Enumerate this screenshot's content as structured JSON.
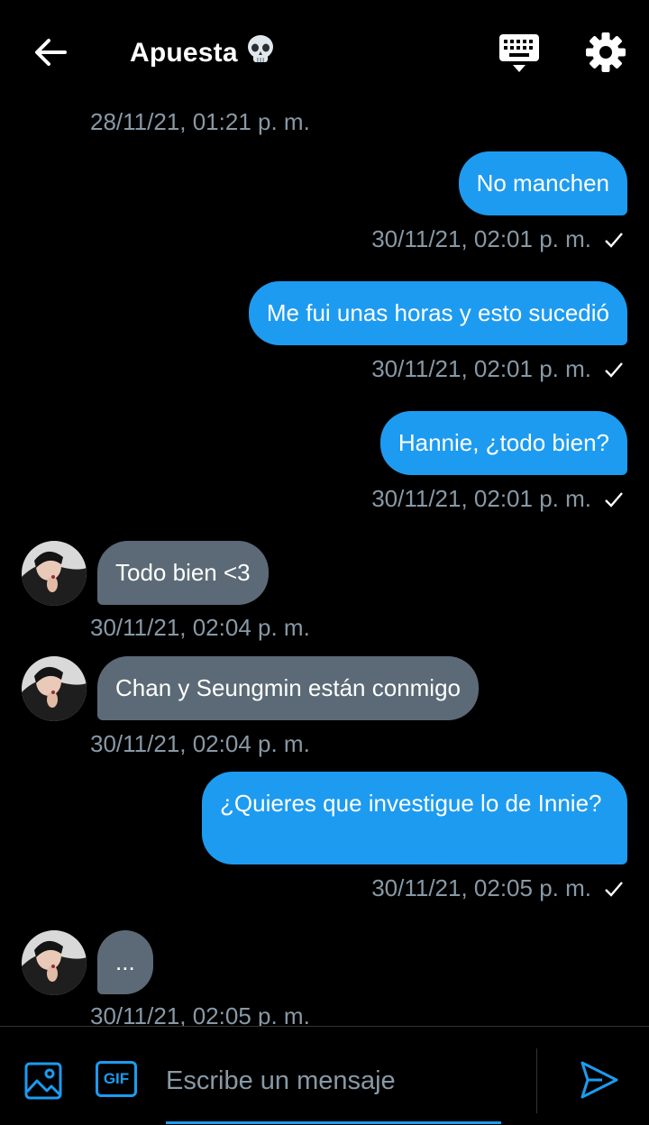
{
  "header": {
    "title": "Apuesta",
    "back_icon": "arrow-left-icon",
    "keyboard_icon": "keyboard-icon",
    "settings_icon": "gear-icon"
  },
  "colors": {
    "background": "#000000",
    "outgoing_bubble": "#1d9bf0",
    "incoming_bubble": "#5b6a76",
    "timestamp": "#8899a6",
    "accent": "#1d9bf0"
  },
  "messages": [
    {
      "timestamp": "28/11/21, 01:21 p. m."
    },
    {
      "direction": "out",
      "text": "No manchen",
      "timestamp": "30/11/21, 02:01 p. m.",
      "read": true
    },
    {
      "direction": "out",
      "text": "Me fui unas horas y esto sucedió",
      "timestamp": "30/11/21, 02:01 p. m.",
      "read": true
    },
    {
      "direction": "out",
      "text": "Hannie, ¿todo bien?",
      "timestamp": "30/11/21, 02:01 p. m.",
      "read": true
    },
    {
      "direction": "in",
      "text": "Todo bien <3",
      "timestamp": "30/11/21, 02:04 p. m."
    },
    {
      "direction": "in",
      "text": "Chan y Seungmin están conmigo",
      "timestamp": "30/11/21, 02:04 p. m."
    },
    {
      "direction": "out",
      "text": "¿Quieres que investigue lo de Innie?",
      "timestamp": "30/11/21, 02:05 p. m.",
      "read": true
    },
    {
      "direction": "in",
      "text": "...",
      "timestamp": "30/11/21, 02:05 p. m."
    }
  ],
  "composer": {
    "placeholder": "Escribe un mensaje",
    "image_icon": "image-icon",
    "gif_label": "GIF",
    "send_icon": "send-icon"
  }
}
